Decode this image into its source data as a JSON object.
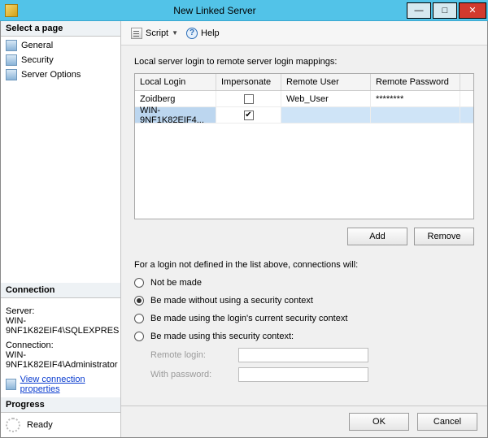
{
  "window": {
    "title": "New Linked Server"
  },
  "titlebar_tools": {
    "min": "—",
    "max": "□",
    "close": "✕"
  },
  "left": {
    "select_page_header": "Select a page",
    "pages": [
      {
        "label": "General"
      },
      {
        "label": "Security"
      },
      {
        "label": "Server Options"
      }
    ],
    "connection_header": "Connection",
    "server_label": "Server:",
    "server_value": "WIN-9NF1K82EIF4\\SQLEXPRES",
    "connection_label": "Connection:",
    "connection_value": "WIN-9NF1K82EIF4\\Administrator",
    "view_props": "View connection properties",
    "progress_header": "Progress",
    "progress_status": "Ready"
  },
  "toolbar": {
    "script": "Script",
    "help": "Help"
  },
  "main": {
    "mappings_label": "Local server login to remote server login mappings:",
    "columns": {
      "local_login": "Local Login",
      "impersonate": "Impersonate",
      "remote_user": "Remote User",
      "remote_password": "Remote Password"
    },
    "rows": [
      {
        "local_login": "Zoidberg",
        "impersonate": false,
        "remote_user": "Web_User",
        "remote_password": "********",
        "selected": false
      },
      {
        "local_login": "WIN-9NF1K82EIF4...",
        "impersonate": true,
        "remote_user": "",
        "remote_password": "",
        "selected": true
      }
    ],
    "add_btn": "Add",
    "remove_btn": "Remove",
    "radio_desc": "For a login not defined in the list above, connections will:",
    "radios": {
      "r1": "Not be made",
      "r2": "Be made without using a security context",
      "r3": "Be made using the login's current security context",
      "r4": "Be made using this security context:"
    },
    "selected_radio": "r2",
    "remote_login_label": "Remote login:",
    "with_password_label": "With password:"
  },
  "footer": {
    "ok": "OK",
    "cancel": "Cancel"
  }
}
